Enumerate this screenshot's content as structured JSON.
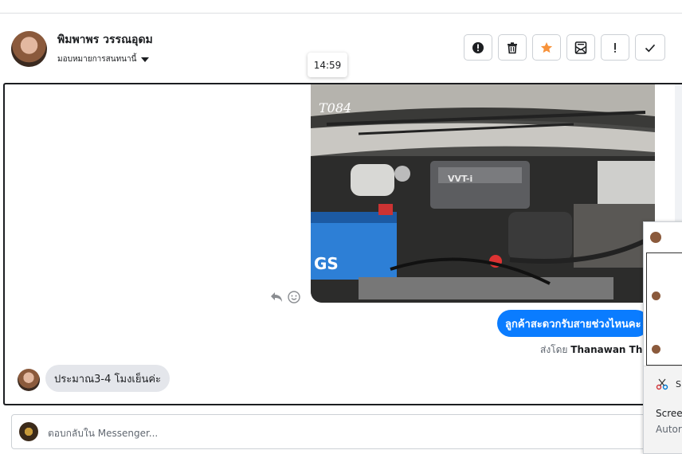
{
  "header": {
    "contact_name": "พิมพาพร วรรณอุดม",
    "assign_label": "มอบหมายการสนทนานี้"
  },
  "actions": [
    {
      "name": "mark-spam",
      "glyph": "!"
    },
    {
      "name": "delete"
    },
    {
      "name": "star"
    },
    {
      "name": "move-to-inbox"
    },
    {
      "name": "mark-important",
      "glyph": "!"
    },
    {
      "name": "mark-done"
    }
  ],
  "tooltip": {
    "time": "14:59"
  },
  "messages": {
    "image": {
      "watermark": "T084",
      "engine_label": "VVT-i",
      "battery_brand": "GS"
    },
    "outgoing_text": "ลูกค้าสะดวกรับสายช่วงไหนคะ",
    "sent_by_prefix": "ส่งโดย",
    "sent_by_name": "Thanawan Thon",
    "incoming_text": "ประมาณ3-4 โมงเย็นค่ะ"
  },
  "composer": {
    "placeholder": "ตอบกลับใน Messenger..."
  },
  "popup": {
    "snip_title": "Sn",
    "line1": "Scree",
    "line2": "Autor"
  },
  "colors": {
    "accent_blue": "#0a7cff",
    "star_orange": "#f7923a",
    "incoming_bg": "#e4e6eb"
  }
}
